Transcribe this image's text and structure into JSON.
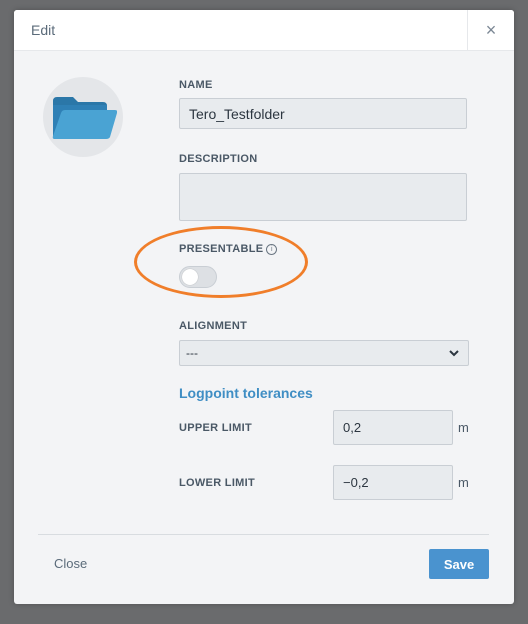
{
  "dialog": {
    "title": "Edit",
    "close_symbol": "×"
  },
  "avatar": {
    "icon": "folder-icon",
    "color": "#3a8ec4"
  },
  "fields": {
    "name_label": "NAME",
    "name_value": "Tero_Testfolder",
    "description_label": "DESCRIPTION",
    "description_value": "",
    "presentable_label": "PRESENTABLE",
    "presentable_info_icon": "info-icon",
    "presentable_on": false,
    "alignment_label": "ALIGNMENT",
    "alignment_value": "---"
  },
  "tolerances": {
    "title": "Logpoint tolerances",
    "upper_label": "UPPER LIMIT",
    "upper_value": "0,2",
    "upper_unit": "m",
    "lower_label": "LOWER LIMIT",
    "lower_value": "−0,2",
    "lower_unit": "m"
  },
  "footer": {
    "close_label": "Close",
    "save_label": "Save"
  },
  "colors": {
    "accent": "#4a93cf",
    "highlight": "#f07e2a",
    "section_title": "#3f8ec4"
  }
}
